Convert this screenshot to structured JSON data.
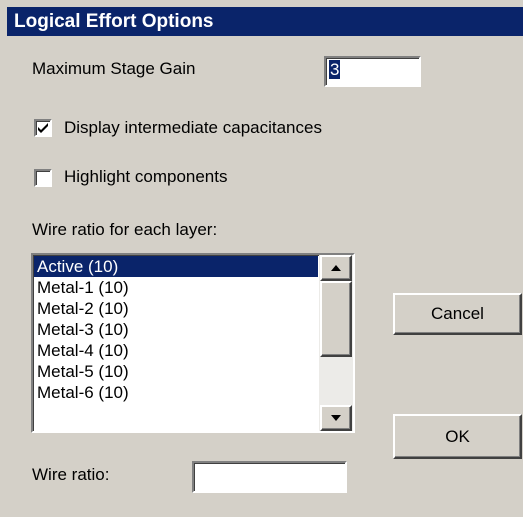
{
  "dialog": {
    "title": "Logical Effort Options"
  },
  "stage_gain": {
    "label": "Maximum Stage Gain",
    "value": "3"
  },
  "options": {
    "display_caps_label": "Display intermediate capacitances",
    "display_caps_checked": true,
    "highlight_label": "Highlight components",
    "highlight_checked": false
  },
  "wire_ratio_list": {
    "label": "Wire ratio for each layer:",
    "items": [
      "Active (10)",
      "Metal-1 (10)",
      "Metal-2 (10)",
      "Metal-3 (10)",
      "Metal-4 (10)",
      "Metal-5 (10)",
      "Metal-6 (10)"
    ],
    "selected_index": 0
  },
  "wire_ratio": {
    "label": "Wire ratio:",
    "value": ""
  },
  "buttons": {
    "cancel": "Cancel",
    "ok": "OK"
  }
}
